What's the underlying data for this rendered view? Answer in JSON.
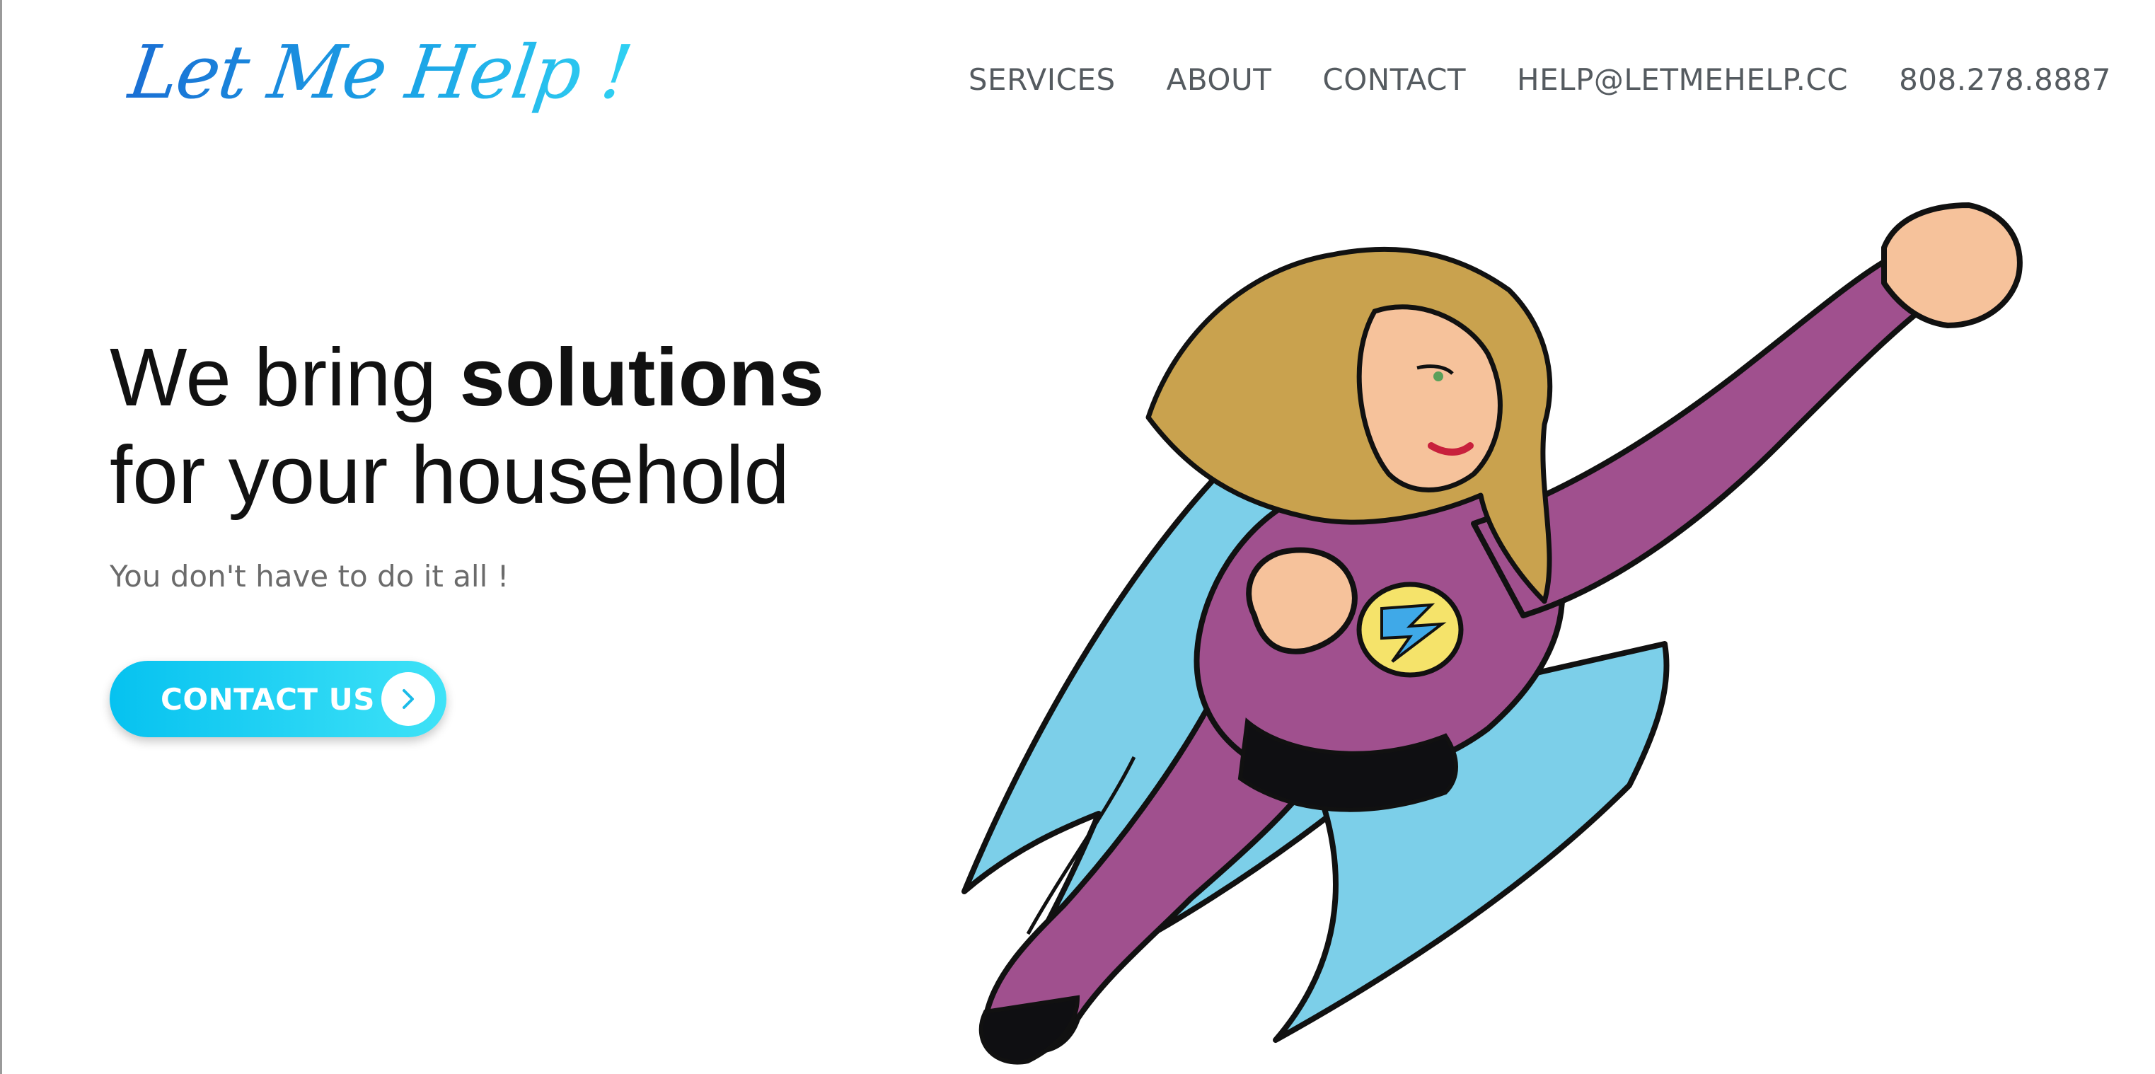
{
  "header": {
    "logo_text": "Let Me Help !",
    "nav": [
      {
        "label": "SERVICES"
      },
      {
        "label": "ABOUT"
      },
      {
        "label": "CONTACT"
      },
      {
        "label": "HELP@LETMEHELP.CC"
      },
      {
        "label": "808.278.8887"
      }
    ]
  },
  "hero": {
    "title_line1_pre": "We bring ",
    "title_line1_bold": "solutions",
    "title_line2": "for your household",
    "subtitle": "You don't have to do it all !",
    "cta_label": "CONTACT US",
    "cta_icon": "chevron-right-icon"
  },
  "illustration": {
    "subject": "superhero-woman-flying",
    "colors": {
      "suit": "#a0508e",
      "cape": "#7ccfe9",
      "hair": "#c9a24e",
      "skin": "#f6c29b",
      "emblem": "#f5e36a",
      "bolt": "#3fa9e8"
    }
  },
  "theme": {
    "accent_start": "#06c2f0",
    "accent_end": "#3fe2f7",
    "logo_start": "#1a6fd4",
    "logo_end": "#2fd0f2",
    "nav_text": "#555b60"
  }
}
